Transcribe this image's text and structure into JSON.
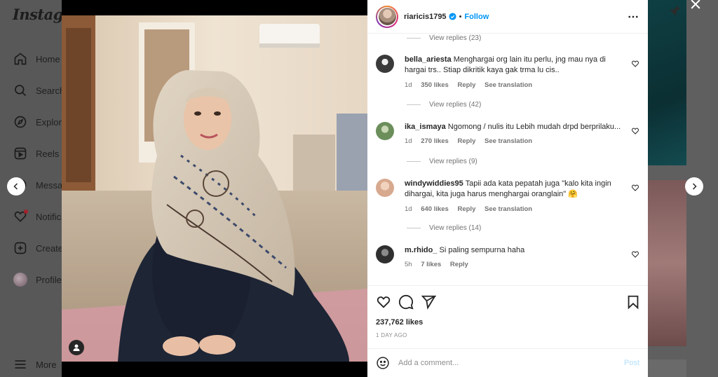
{
  "app": {
    "logo_text": "Instagram"
  },
  "sidebar": {
    "items": [
      {
        "label": "Home",
        "icon": "home-icon"
      },
      {
        "label": "Search",
        "icon": "search-icon"
      },
      {
        "label": "Explore",
        "icon": "compass-icon"
      },
      {
        "label": "Reels",
        "icon": "reels-icon"
      },
      {
        "label": "Messages",
        "icon": "messenger-icon"
      },
      {
        "label": "Notifications",
        "icon": "heart-icon"
      },
      {
        "label": "Create",
        "icon": "plus-square-icon"
      },
      {
        "label": "Profile",
        "icon": "avatar"
      }
    ],
    "more_label": "More"
  },
  "post": {
    "username": "riaricis1795",
    "verified": true,
    "separator": "•",
    "follow_label": "Follow",
    "likes": "237,762 likes",
    "date": "1 DAY AGO"
  },
  "comments": {
    "top_replies": "View replies (23)",
    "items": [
      {
        "username": "bella_ariesta",
        "text": "Menghargai org lain itu perlu, jng mau nya di hargai trs.. Stiap dikritik kaya gak trma lu cis..",
        "age": "1d",
        "likes": "350 likes",
        "reply": "Reply",
        "translate": "See translation",
        "replies": "View replies (42)",
        "avatar_color": "#3a3a3a"
      },
      {
        "username": "ika_ismaya",
        "text": "Ngomong / nulis itu Lebih mudah drpd berprilaku...",
        "age": "1d",
        "likes": "270 likes",
        "reply": "Reply",
        "translate": "See translation",
        "replies": "View replies (9)",
        "avatar_color": "#6b8e5a"
      },
      {
        "username": "windywiddies95",
        "text": "Tapii ada kata pepatah juga \"kalo kita ingin dihargai, kita juga harus menghargai oranglain\" 🤗",
        "age": "1d",
        "likes": "640 likes",
        "reply": "Reply",
        "translate": "See translation",
        "replies": "View replies (14)",
        "avatar_color": "#d7a98f"
      },
      {
        "username": "m.rhido_",
        "text": "Si paling sempurna haha",
        "age": "5h",
        "likes": "7 likes",
        "reply": "Reply",
        "translate": "",
        "replies": "",
        "avatar_color": "#2f2f2f"
      }
    ]
  },
  "composer": {
    "placeholder": "Add a comment...",
    "post_label": "Post"
  },
  "colors": {
    "accent": "#0095f6",
    "post_disabled": "#b2dffc",
    "overlay": "#5d5d5d"
  }
}
